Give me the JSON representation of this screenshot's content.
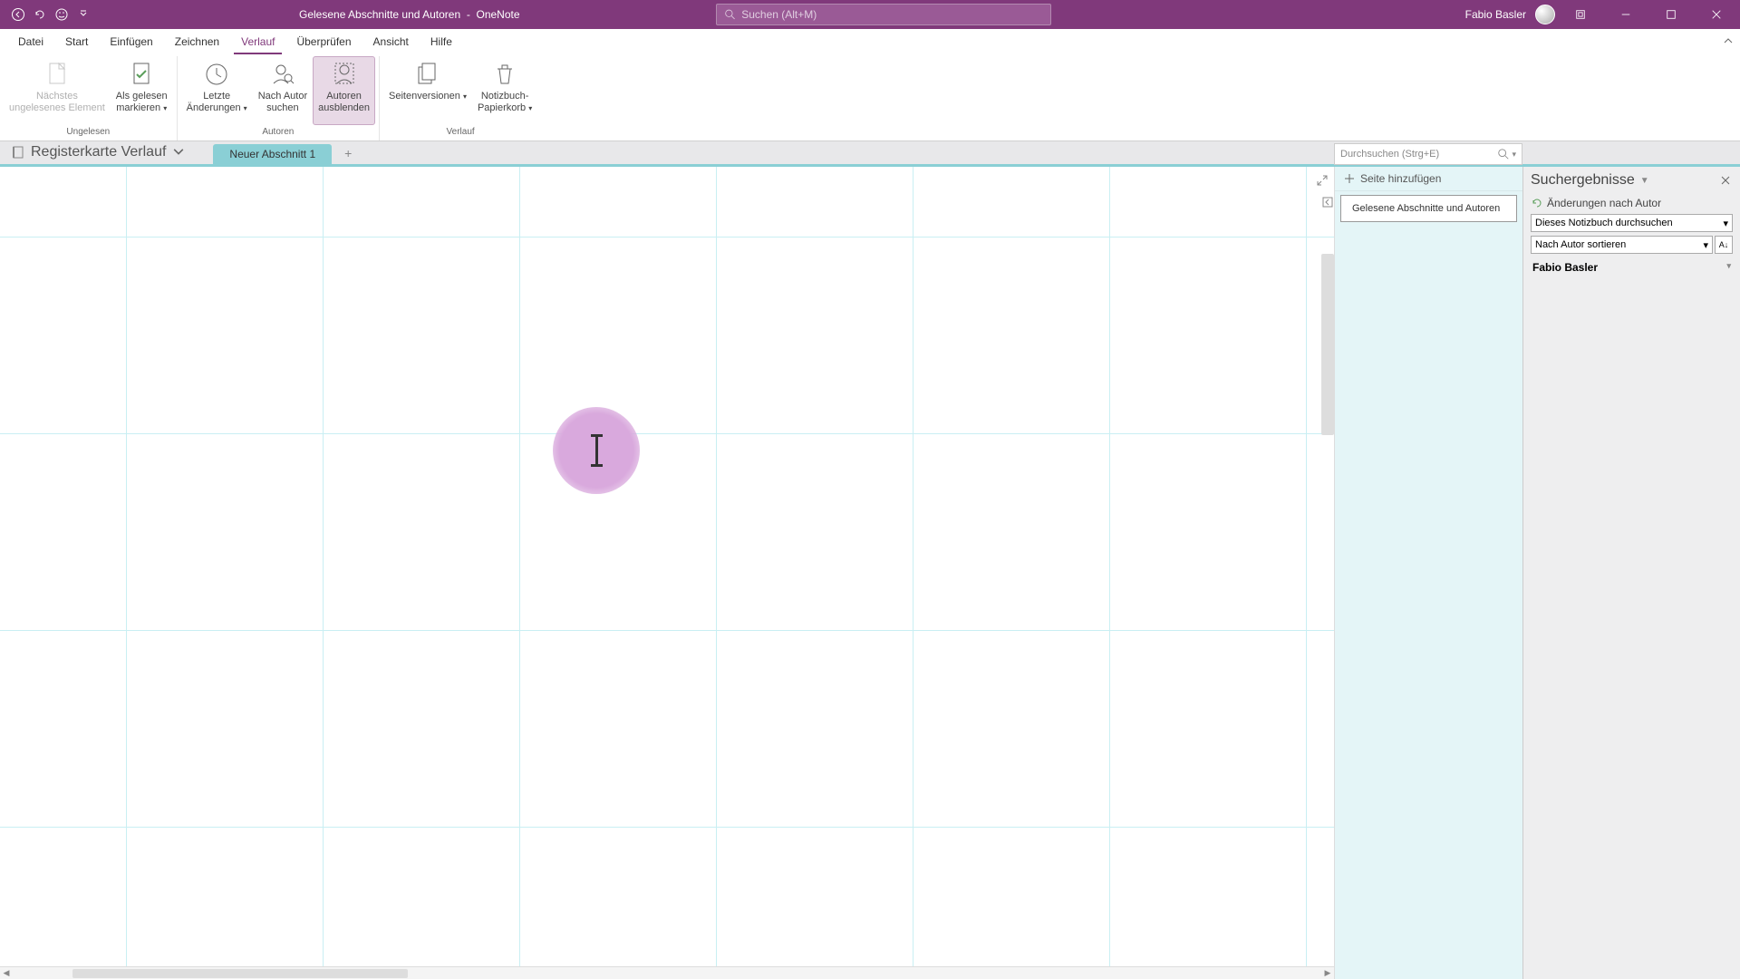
{
  "titlebar": {
    "doc_title": "Gelesene Abschnitte und Autoren",
    "separator": "-",
    "app_name": "OneNote",
    "search_placeholder": "Suchen (Alt+M)",
    "user_name": "Fabio Basler"
  },
  "tabs": {
    "items": [
      "Datei",
      "Start",
      "Einfügen",
      "Zeichnen",
      "Verlauf",
      "Überprüfen",
      "Ansicht",
      "Hilfe"
    ],
    "active_index": 4
  },
  "ribbon": {
    "groups": [
      {
        "label": "Ungelesen",
        "buttons": [
          {
            "name": "naechstes-ungelesenes",
            "label": "Nächstes\nungelesenes Element",
            "disabled": true,
            "dropdown": false,
            "icon": "page"
          },
          {
            "name": "als-gelesen",
            "label": "Als gelesen\nmarkieren",
            "disabled": false,
            "dropdown": true,
            "icon": "page-check"
          }
        ]
      },
      {
        "label": "Autoren",
        "buttons": [
          {
            "name": "letzte-aenderungen",
            "label": "Letzte\nÄnderungen",
            "disabled": false,
            "dropdown": true,
            "icon": "clock"
          },
          {
            "name": "nach-autor-suchen",
            "label": "Nach Autor\nsuchen",
            "disabled": false,
            "dropdown": false,
            "icon": "person-search"
          },
          {
            "name": "autoren-ausblenden",
            "label": "Autoren\nausblenden",
            "disabled": false,
            "dropdown": false,
            "icon": "person-hide",
            "active": true
          }
        ]
      },
      {
        "label": "Verlauf",
        "buttons": [
          {
            "name": "seitenversionen",
            "label": "Seitenversionen",
            "disabled": false,
            "dropdown": true,
            "icon": "versions"
          },
          {
            "name": "notizbuch-papierkorb",
            "label": "Notizbuch-\nPapierkorb",
            "disabled": false,
            "dropdown": true,
            "icon": "trash"
          }
        ]
      }
    ]
  },
  "notebook": {
    "name": "Registerkarte Verlauf",
    "section_tab": "Neuer Abschnitt 1",
    "local_search_placeholder": "Durchsuchen (Strg+E)"
  },
  "pagelist": {
    "add_label": "Seite hinzufügen",
    "pages": [
      "Gelesene Abschnitte und Autoren"
    ]
  },
  "searchpane": {
    "title": "Suchergebnisse",
    "changes_label": "Änderungen nach Autor",
    "scope_options": [
      "Dieses Notizbuch durchsuchen"
    ],
    "sort_options": [
      "Nach Autor sortieren"
    ],
    "author": "Fabio Basler"
  }
}
